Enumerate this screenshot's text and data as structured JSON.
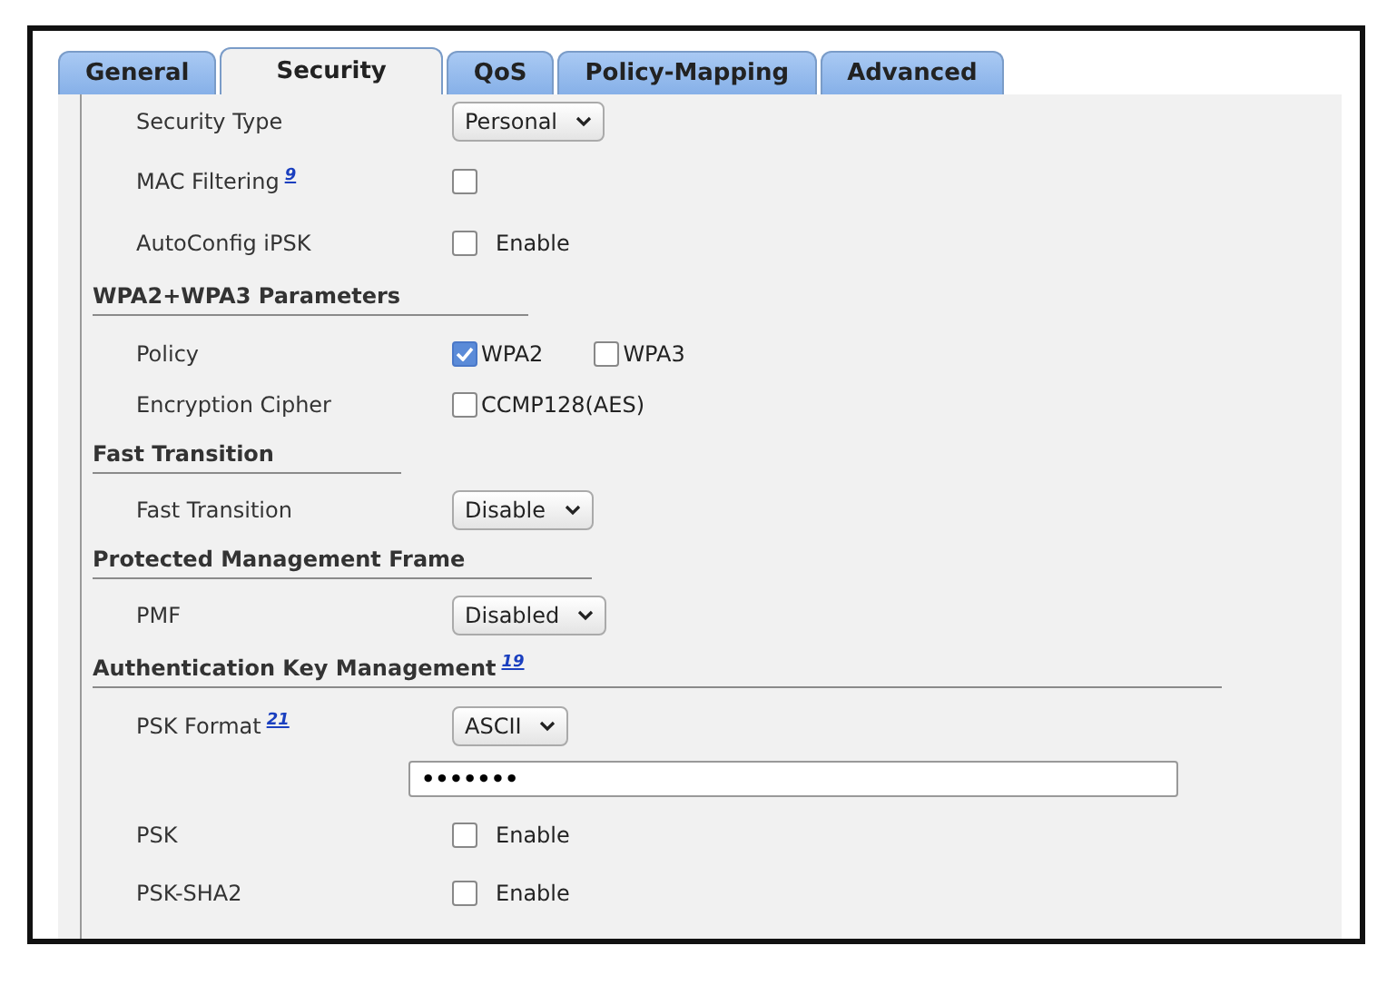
{
  "tabs": [
    {
      "label": "General",
      "selected": false
    },
    {
      "label": "Security",
      "selected": true
    },
    {
      "label": "QoS",
      "selected": false
    },
    {
      "label": "Policy-Mapping",
      "selected": false
    },
    {
      "label": "Advanced",
      "selected": false
    }
  ],
  "rows": [
    {
      "kind": "select",
      "label": "Security Type",
      "value": "Personal"
    },
    {
      "kind": "checkbox",
      "label": "MAC Filtering",
      "note": "9",
      "checked": false
    },
    {
      "kind": "checkbox",
      "label": "AutoConfig iPSK",
      "checked": false,
      "text": "Enable"
    },
    {
      "kind": "header",
      "label": "WPA2+WPA3 Parameters"
    },
    {
      "kind": "checkgroup",
      "label": "Policy",
      "options": [
        {
          "text": "WPA2",
          "checked": true
        },
        {
          "text": "WPA3",
          "checked": false
        }
      ]
    },
    {
      "kind": "checkgroup",
      "label": "Encryption Cipher",
      "options": [
        {
          "text": "CCMP128(AES)",
          "checked": false
        }
      ]
    },
    {
      "kind": "header",
      "label": "Fast Transition"
    },
    {
      "kind": "select",
      "label": "Fast Transition",
      "value": "Disable"
    },
    {
      "kind": "header",
      "label": "Protected Management Frame"
    },
    {
      "kind": "select",
      "label": "PMF",
      "value": "Disabled"
    },
    {
      "kind": "header",
      "label": "Authentication Key Management",
      "note": "19"
    },
    {
      "kind": "select",
      "label": "PSK Format",
      "note": "21",
      "value": "ASCII"
    },
    {
      "kind": "password",
      "value": "•••••••"
    },
    {
      "kind": "checkbox",
      "label": "PSK",
      "checked": false,
      "text": "Enable"
    },
    {
      "kind": "checkbox",
      "label": "PSK-SHA2",
      "checked": false,
      "text": "Enable"
    }
  ]
}
